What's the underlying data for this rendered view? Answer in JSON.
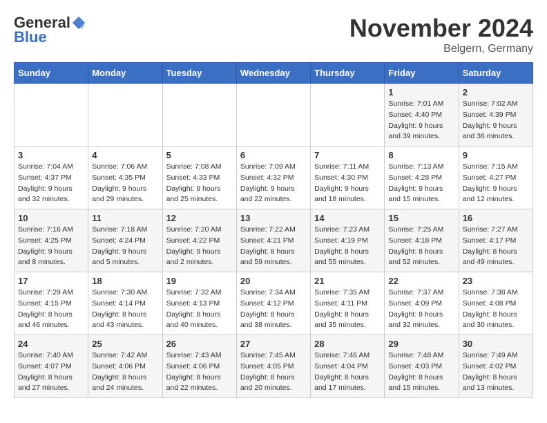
{
  "header": {
    "logo_general": "General",
    "logo_blue": "Blue",
    "month_title": "November 2024",
    "location": "Belgern, Germany"
  },
  "days_of_week": [
    "Sunday",
    "Monday",
    "Tuesday",
    "Wednesday",
    "Thursday",
    "Friday",
    "Saturday"
  ],
  "weeks": [
    [
      {
        "day": "",
        "info": ""
      },
      {
        "day": "",
        "info": ""
      },
      {
        "day": "",
        "info": ""
      },
      {
        "day": "",
        "info": ""
      },
      {
        "day": "",
        "info": ""
      },
      {
        "day": "1",
        "info": "Sunrise: 7:01 AM\nSunset: 4:40 PM\nDaylight: 9 hours\nand 39 minutes."
      },
      {
        "day": "2",
        "info": "Sunrise: 7:02 AM\nSunset: 4:39 PM\nDaylight: 9 hours\nand 36 minutes."
      }
    ],
    [
      {
        "day": "3",
        "info": "Sunrise: 7:04 AM\nSunset: 4:37 PM\nDaylight: 9 hours\nand 32 minutes."
      },
      {
        "day": "4",
        "info": "Sunrise: 7:06 AM\nSunset: 4:35 PM\nDaylight: 9 hours\nand 29 minutes."
      },
      {
        "day": "5",
        "info": "Sunrise: 7:08 AM\nSunset: 4:33 PM\nDaylight: 9 hours\nand 25 minutes."
      },
      {
        "day": "6",
        "info": "Sunrise: 7:09 AM\nSunset: 4:32 PM\nDaylight: 9 hours\nand 22 minutes."
      },
      {
        "day": "7",
        "info": "Sunrise: 7:11 AM\nSunset: 4:30 PM\nDaylight: 9 hours\nand 18 minutes."
      },
      {
        "day": "8",
        "info": "Sunrise: 7:13 AM\nSunset: 4:28 PM\nDaylight: 9 hours\nand 15 minutes."
      },
      {
        "day": "9",
        "info": "Sunrise: 7:15 AM\nSunset: 4:27 PM\nDaylight: 9 hours\nand 12 minutes."
      }
    ],
    [
      {
        "day": "10",
        "info": "Sunrise: 7:16 AM\nSunset: 4:25 PM\nDaylight: 9 hours\nand 8 minutes."
      },
      {
        "day": "11",
        "info": "Sunrise: 7:18 AM\nSunset: 4:24 PM\nDaylight: 9 hours\nand 5 minutes."
      },
      {
        "day": "12",
        "info": "Sunrise: 7:20 AM\nSunset: 4:22 PM\nDaylight: 9 hours\nand 2 minutes."
      },
      {
        "day": "13",
        "info": "Sunrise: 7:22 AM\nSunset: 4:21 PM\nDaylight: 8 hours\nand 59 minutes."
      },
      {
        "day": "14",
        "info": "Sunrise: 7:23 AM\nSunset: 4:19 PM\nDaylight: 8 hours\nand 55 minutes."
      },
      {
        "day": "15",
        "info": "Sunrise: 7:25 AM\nSunset: 4:18 PM\nDaylight: 8 hours\nand 52 minutes."
      },
      {
        "day": "16",
        "info": "Sunrise: 7:27 AM\nSunset: 4:17 PM\nDaylight: 8 hours\nand 49 minutes."
      }
    ],
    [
      {
        "day": "17",
        "info": "Sunrise: 7:29 AM\nSunset: 4:15 PM\nDaylight: 8 hours\nand 46 minutes."
      },
      {
        "day": "18",
        "info": "Sunrise: 7:30 AM\nSunset: 4:14 PM\nDaylight: 8 hours\nand 43 minutes."
      },
      {
        "day": "19",
        "info": "Sunrise: 7:32 AM\nSunset: 4:13 PM\nDaylight: 8 hours\nand 40 minutes."
      },
      {
        "day": "20",
        "info": "Sunrise: 7:34 AM\nSunset: 4:12 PM\nDaylight: 8 hours\nand 38 minutes."
      },
      {
        "day": "21",
        "info": "Sunrise: 7:35 AM\nSunset: 4:11 PM\nDaylight: 8 hours\nand 35 minutes."
      },
      {
        "day": "22",
        "info": "Sunrise: 7:37 AM\nSunset: 4:09 PM\nDaylight: 8 hours\nand 32 minutes."
      },
      {
        "day": "23",
        "info": "Sunrise: 7:38 AM\nSunset: 4:08 PM\nDaylight: 8 hours\nand 30 minutes."
      }
    ],
    [
      {
        "day": "24",
        "info": "Sunrise: 7:40 AM\nSunset: 4:07 PM\nDaylight: 8 hours\nand 27 minutes."
      },
      {
        "day": "25",
        "info": "Sunrise: 7:42 AM\nSunset: 4:06 PM\nDaylight: 8 hours\nand 24 minutes."
      },
      {
        "day": "26",
        "info": "Sunrise: 7:43 AM\nSunset: 4:06 PM\nDaylight: 8 hours\nand 22 minutes."
      },
      {
        "day": "27",
        "info": "Sunrise: 7:45 AM\nSunset: 4:05 PM\nDaylight: 8 hours\nand 20 minutes."
      },
      {
        "day": "28",
        "info": "Sunrise: 7:46 AM\nSunset: 4:04 PM\nDaylight: 8 hours\nand 17 minutes."
      },
      {
        "day": "29",
        "info": "Sunrise: 7:48 AM\nSunset: 4:03 PM\nDaylight: 8 hours\nand 15 minutes."
      },
      {
        "day": "30",
        "info": "Sunrise: 7:49 AM\nSunset: 4:02 PM\nDaylight: 8 hours\nand 13 minutes."
      }
    ]
  ]
}
